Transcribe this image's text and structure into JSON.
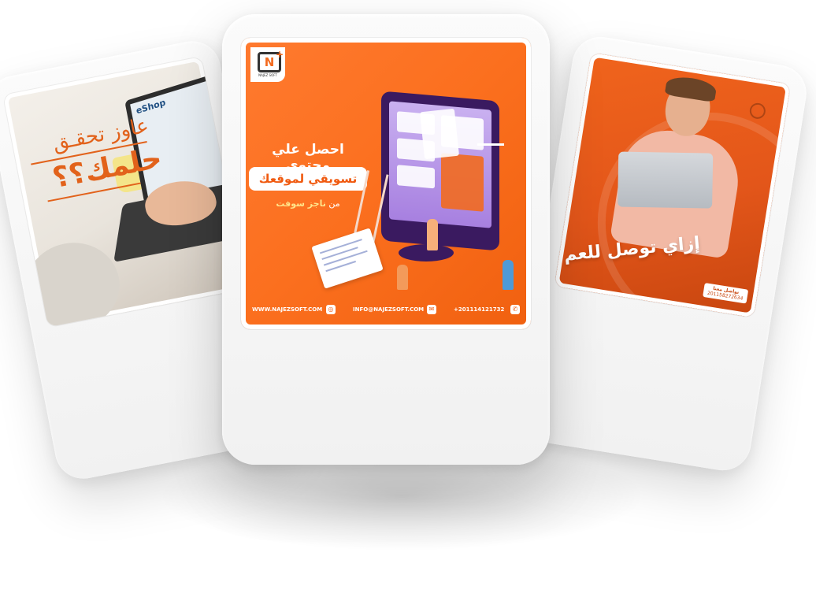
{
  "left_card": {
    "laptop_brand": "eShop",
    "line1": "عاوز تحقـق",
    "line2": "حلمك؟؟"
  },
  "center_card": {
    "logo_caption": "NAJEZ SOFT",
    "headline": "احصل علي محتوي",
    "pill_text": "تسويقي لموقعك",
    "sub_prefix": "من",
    "sub_brand": "ناجز سوفت",
    "footer": {
      "website": "WWW.NAJEZSOFT.COM",
      "email": "INFO@NAJEZSOFT.COM",
      "phone": "+201114121732"
    },
    "colors": {
      "accent": "#f36a1e",
      "pill_text": "#f05a10"
    }
  },
  "right_card": {
    "headline": "إزاي توصل للعم",
    "contact_label": "تواصل معنا",
    "contact_phone": "201158272634"
  }
}
